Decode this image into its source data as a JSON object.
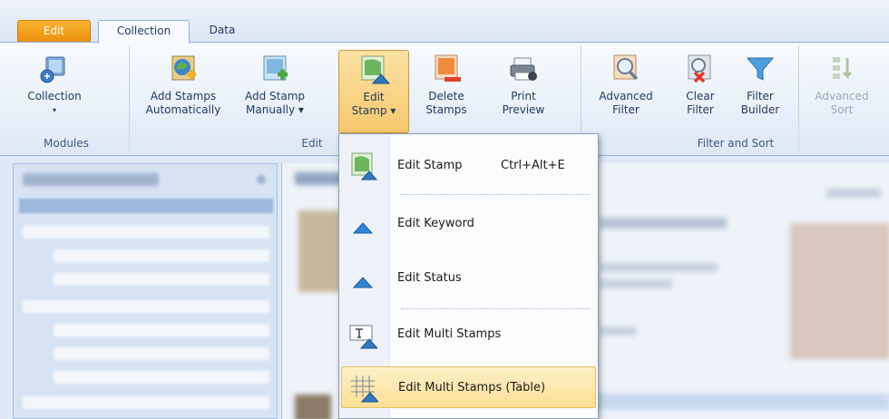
{
  "tabs": {
    "app": "Edit",
    "collection": "Collection",
    "data": "Data"
  },
  "ribbon": {
    "modules": {
      "label": "Modules",
      "collection_line1": "Collection",
      "collection_arrow": "▾"
    },
    "edit": {
      "label": "Edit",
      "add_auto_line1": "Add Stamps",
      "add_auto_line2": "Automatically",
      "add_manual_line1": "Add Stamp",
      "add_manual_line2": "Manually ▾",
      "edit_stamp_line1": "Edit",
      "edit_stamp_line2": "Stamp ▾",
      "delete_line1": "Delete",
      "delete_line2": "Stamps",
      "print_line1": "Print",
      "print_line2": "Preview"
    },
    "filter": {
      "label": "Filter and Sort",
      "advanced_filter_line1": "Advanced",
      "advanced_filter_line2": "Filter",
      "clear_filter_line1": "Clear",
      "clear_filter_line2": "Filter",
      "filter_builder_line1": "Filter",
      "filter_builder_line2": "Builder",
      "advanced_sort_line1": "Advanced",
      "advanced_sort_line2": "Sort"
    }
  },
  "menu": {
    "items": [
      {
        "label": "Edit Stamp",
        "shortcut": "Ctrl+Alt+E"
      },
      {
        "label": "Edit Keyword"
      },
      {
        "label": "Edit Status"
      },
      {
        "label": "Edit Multi Stamps"
      },
      {
        "label": "Edit Multi Stamps (Table)"
      }
    ]
  },
  "colors": {
    "app_tab": "#f0a020",
    "ribbon_border": "#8db2e3",
    "menu_hover": "#fbe096"
  }
}
